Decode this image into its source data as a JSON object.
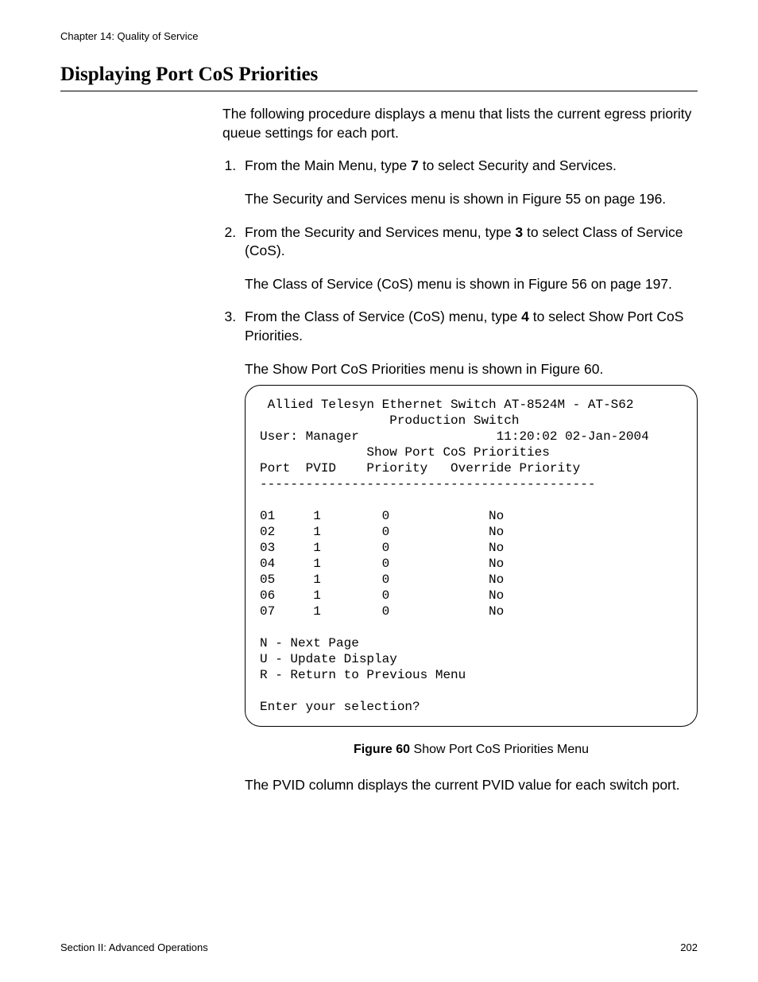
{
  "header": {
    "chapter": "Chapter 14: Quality of Service"
  },
  "title": "Displaying Port CoS Priorities",
  "intro": "The following procedure displays a menu that lists the current egress priority queue settings for each port.",
  "steps": {
    "s1": {
      "prefix": "From the Main Menu, type ",
      "key": "7",
      "suffix": " to select Security and Services.",
      "note": "The Security and Services menu is shown in Figure 55 on page 196."
    },
    "s2": {
      "prefix": "From the Security and Services menu, type ",
      "key": "3",
      "suffix": " to select Class of Service (CoS).",
      "note": "The Class of Service (CoS) menu is shown in Figure 56 on page 197."
    },
    "s3": {
      "prefix": "From the Class of Service (CoS) menu, type ",
      "key": "4",
      "suffix": " to select Show Port CoS Priorities.",
      "note": "The Show Port CoS Priorities menu is shown in Figure 60."
    }
  },
  "terminal": {
    "line1": " Allied Telesyn Ethernet Switch AT-8524M - AT-S62",
    "line2": "                 Production Switch",
    "user": "User: Manager                  11:20:02 02-Jan-2004",
    "menu_title": "              Show Port CoS Priorities",
    "columns": "Port  PVID    Priority   Override Priority",
    "divider": "--------------------------------------------",
    "rows": [
      "01     1        0             No",
      "02     1        0             No",
      "03     1        0             No",
      "04     1        0             No",
      "05     1        0             No",
      "06     1        0             No",
      "07     1        0             No"
    ],
    "nav": {
      "n": "N - Next Page",
      "u": "U - Update Display",
      "r": "R - Return to Previous Menu"
    },
    "prompt": "Enter your selection?"
  },
  "figure": {
    "label": "Figure 60",
    "caption": "  Show Port CoS Priorities Menu"
  },
  "after_figure": "The PVID column displays the current PVID value for each switch port.",
  "footer": {
    "section": "Section II: Advanced Operations",
    "page": "202"
  },
  "chart_data": {
    "type": "table",
    "title": "Show Port CoS Priorities",
    "columns": [
      "Port",
      "PVID",
      "Priority",
      "Override Priority"
    ],
    "rows": [
      [
        "01",
        1,
        0,
        "No"
      ],
      [
        "02",
        1,
        0,
        "No"
      ],
      [
        "03",
        1,
        0,
        "No"
      ],
      [
        "04",
        1,
        0,
        "No"
      ],
      [
        "05",
        1,
        0,
        "No"
      ],
      [
        "06",
        1,
        0,
        "No"
      ],
      [
        "07",
        1,
        0,
        "No"
      ]
    ]
  }
}
